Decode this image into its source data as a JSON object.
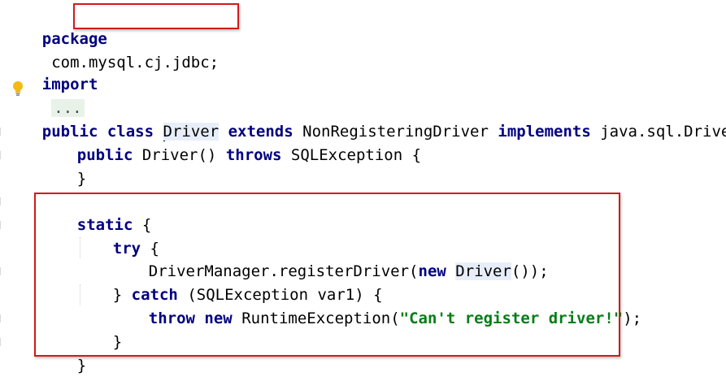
{
  "editor": {
    "language": "Java",
    "code": {
      "package_kw": "package",
      "package_name": "com.mysql.cj.jdbc;",
      "import_kw": "import",
      "import_folded": "...",
      "class_decl": {
        "public_kw": "public",
        "class_kw": "class",
        "class_name": "Driver",
        "extends_kw": "extends",
        "super_class": "NonRegisteringDriver",
        "implements_kw": "implements",
        "interface": "java.sql.Driver",
        "open_brace": "{"
      },
      "constructor": {
        "public_kw": "public",
        "signature": "Driver()",
        "throws_kw": "throws",
        "exception": "SQLException",
        "open_brace": "{",
        "close_brace": "}"
      },
      "static_block": {
        "static_kw": "static",
        "open_brace": "{",
        "try_kw": "try",
        "try_open": "{",
        "register_prefix": "DriverManager.registerDriver(",
        "new_kw": "new",
        "driver_ref": "Driver",
        "register_suffix": "());",
        "catch_close": "}",
        "catch_kw": "catch",
        "catch_params": "(SQLException var1) {",
        "throw_kw": "throw",
        "throw_new_kw": "new",
        "exception_ctor": "RuntimeException(",
        "message": "\"Can't register driver!\"",
        "throw_suffix": ");",
        "catch_end": "}",
        "static_end": "}"
      },
      "class_close": "}"
    },
    "icons": {
      "intention": "lightbulb-icon"
    },
    "colors": {
      "keyword": "#000080",
      "string": "#067d17",
      "annotation_box": "#d11a1a"
    }
  }
}
